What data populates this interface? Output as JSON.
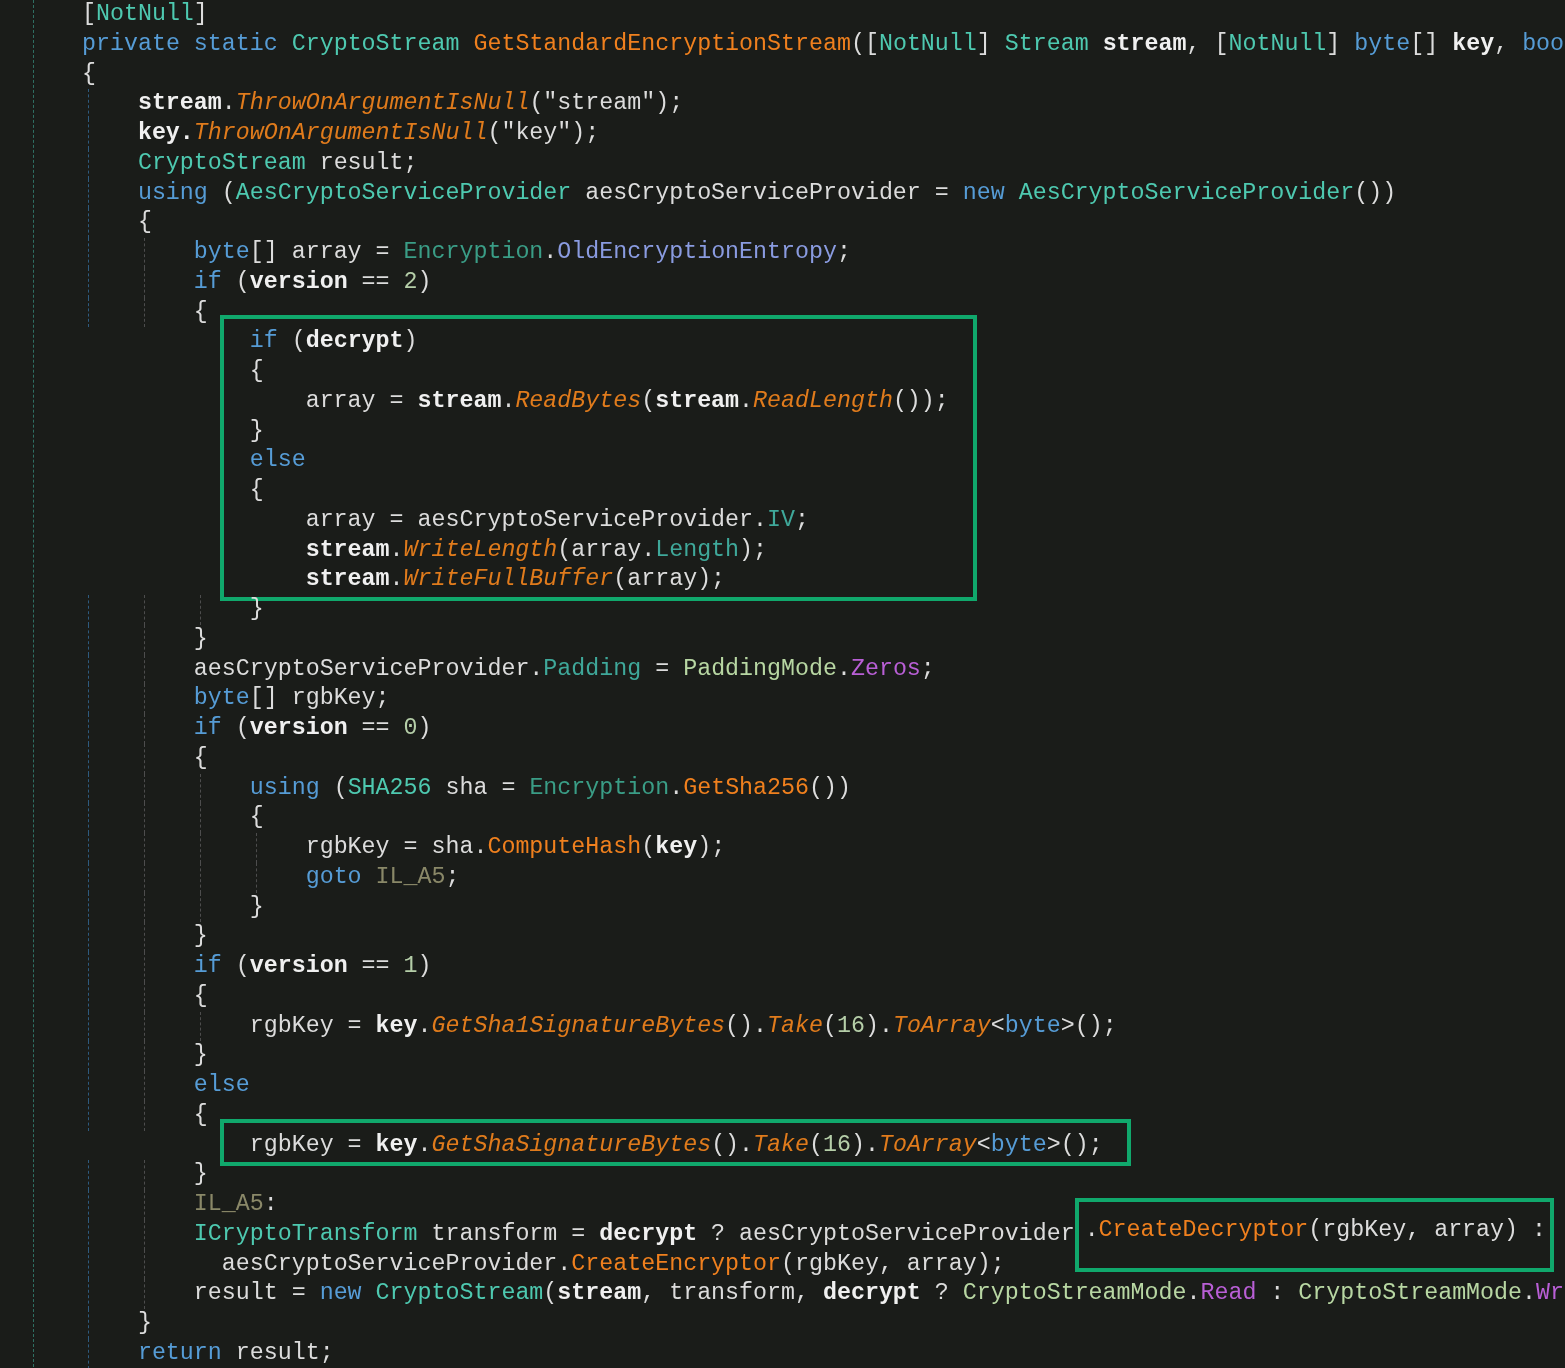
{
  "code_lines": [
    {
      "tokens": [
        {
          "text": "[",
          "kind": "plain"
        },
        {
          "text": "NotNull",
          "kind": "type"
        },
        {
          "text": "]",
          "kind": "plain"
        }
      ]
    },
    {
      "tokens": [
        {
          "text": "private static ",
          "kind": "keyword"
        },
        {
          "text": "CryptoStream ",
          "kind": "type"
        },
        {
          "text": "GetStandardEncryptionStream",
          "kind": "method"
        },
        {
          "text": "([",
          "kind": "plain"
        },
        {
          "text": "NotNull",
          "kind": "type"
        },
        {
          "text": "] ",
          "kind": "plain"
        },
        {
          "text": "Stream ",
          "kind": "type"
        },
        {
          "text": "stream",
          "kind": "parameter"
        },
        {
          "text": ", [",
          "kind": "plain"
        },
        {
          "text": "NotNull",
          "kind": "type"
        },
        {
          "text": "] ",
          "kind": "plain"
        },
        {
          "text": "byte",
          "kind": "keyword"
        },
        {
          "text": "[] ",
          "kind": "plain"
        },
        {
          "text": "key",
          "kind": "parameter"
        },
        {
          "text": ", ",
          "kind": "plain"
        },
        {
          "text": "boo",
          "kind": "keyword"
        }
      ]
    },
    {
      "tokens": [
        {
          "text": "{",
          "kind": "plain"
        }
      ]
    },
    {
      "tokens": [
        {
          "text": "    stream",
          "kind": "parameter"
        },
        {
          "text": ".",
          "kind": "plain"
        },
        {
          "text": "ThrowOnArgumentIsNull",
          "kind": "extension"
        },
        {
          "text": "(\"stream\");",
          "kind": "plain"
        }
      ]
    },
    {
      "tokens": [
        {
          "text": "    key.",
          "kind": "parameter"
        },
        {
          "text": "ThrowOnArgumentIsNull",
          "kind": "extension"
        },
        {
          "text": "(\"key\");",
          "kind": "plain"
        }
      ]
    },
    {
      "tokens": [
        {
          "text": "    CryptoStream",
          "kind": "type"
        },
        {
          "text": " result;",
          "kind": "plain"
        }
      ]
    },
    {
      "tokens": [
        {
          "text": "    using",
          "kind": "keyword"
        },
        {
          "text": " (",
          "kind": "plain"
        },
        {
          "text": "AesCryptoServiceProvider",
          "kind": "type"
        },
        {
          "text": " aesCryptoServiceProvider = ",
          "kind": "plain"
        },
        {
          "text": "new ",
          "kind": "keyword"
        },
        {
          "text": "AesCryptoServiceProvider",
          "kind": "type"
        },
        {
          "text": "())",
          "kind": "plain"
        }
      ]
    },
    {
      "tokens": [
        {
          "text": "    {",
          "kind": "plain"
        }
      ]
    },
    {
      "tokens": [
        {
          "text": "        byte",
          "kind": "keyword"
        },
        {
          "text": "[] array = ",
          "kind": "plain"
        },
        {
          "text": "Encryption",
          "kind": "static_type"
        },
        {
          "text": ".",
          "kind": "plain"
        },
        {
          "text": "OldEncryptionEntropy",
          "kind": "field"
        },
        {
          "text": ";",
          "kind": "plain"
        }
      ]
    },
    {
      "tokens": [
        {
          "text": "        if",
          "kind": "keyword"
        },
        {
          "text": " (",
          "kind": "plain"
        },
        {
          "text": "version",
          "kind": "parameter"
        },
        {
          "text": " == ",
          "kind": "plain"
        },
        {
          "text": "2",
          "kind": "number"
        },
        {
          "text": ")",
          "kind": "plain"
        }
      ]
    },
    {
      "tokens": [
        {
          "text": "        {",
          "kind": "plain"
        }
      ]
    },
    {
      "kind": "highlight",
      "lines": [
        {
          "tokens": [
            {
              "text": "            if",
              "kind": "keyword"
            },
            {
              "text": " (",
              "kind": "plain"
            },
            {
              "text": "decrypt",
              "kind": "parameter"
            },
            {
              "text": ")",
              "kind": "plain"
            }
          ]
        },
        {
          "tokens": [
            {
              "text": "            {",
              "kind": "plain"
            }
          ]
        },
        {
          "tokens": [
            {
              "text": "                array = ",
              "kind": "plain"
            },
            {
              "text": "stream",
              "kind": "parameter"
            },
            {
              "text": ".",
              "kind": "plain"
            },
            {
              "text": "ReadBytes",
              "kind": "extension"
            },
            {
              "text": "(",
              "kind": "plain"
            },
            {
              "text": "stream",
              "kind": "parameter"
            },
            {
              "text": ".",
              "kind": "plain"
            },
            {
              "text": "ReadLength",
              "kind": "extension"
            },
            {
              "text": "());",
              "kind": "plain"
            }
          ]
        },
        {
          "tokens": [
            {
              "text": "            }",
              "kind": "plain"
            }
          ]
        },
        {
          "tokens": [
            {
              "text": "            else",
              "kind": "keyword"
            }
          ]
        },
        {
          "tokens": [
            {
              "text": "            {",
              "kind": "plain"
            }
          ]
        },
        {
          "tokens": [
            {
              "text": "                array = aesCryptoServiceProvider.",
              "kind": "plain"
            },
            {
              "text": "IV",
              "kind": "property"
            },
            {
              "text": ";",
              "kind": "plain"
            }
          ]
        },
        {
          "tokens": [
            {
              "text": "                stream",
              "kind": "parameter"
            },
            {
              "text": ".",
              "kind": "plain"
            },
            {
              "text": "WriteLength",
              "kind": "extension"
            },
            {
              "text": "(array.",
              "kind": "plain"
            },
            {
              "text": "Length",
              "kind": "property"
            },
            {
              "text": ");",
              "kind": "plain"
            }
          ]
        },
        {
          "tokens": [
            {
              "text": "                stream",
              "kind": "parameter"
            },
            {
              "text": ".",
              "kind": "plain"
            },
            {
              "text": "WriteFullBuffer",
              "kind": "extension"
            },
            {
              "text": "(array);",
              "kind": "plain"
            }
          ]
        }
      ]
    },
    {
      "tokens": [
        {
          "text": "            }",
          "kind": "plain"
        }
      ]
    },
    {
      "tokens": [
        {
          "text": "        }",
          "kind": "plain"
        }
      ]
    },
    {
      "tokens": [
        {
          "text": "        aesCryptoServiceProvider.",
          "kind": "plain"
        },
        {
          "text": "Padding",
          "kind": "property"
        },
        {
          "text": " = ",
          "kind": "plain"
        },
        {
          "text": "PaddingMode",
          "kind": "enum_type"
        },
        {
          "text": ".",
          "kind": "plain"
        },
        {
          "text": "Zeros",
          "kind": "enum_member"
        },
        {
          "text": ";",
          "kind": "plain"
        }
      ]
    },
    {
      "tokens": [
        {
          "text": "        byte",
          "kind": "keyword"
        },
        {
          "text": "[] rgbKey;",
          "kind": "plain"
        }
      ]
    },
    {
      "tokens": [
        {
          "text": "        if",
          "kind": "keyword"
        },
        {
          "text": " (",
          "kind": "plain"
        },
        {
          "text": "version",
          "kind": "parameter"
        },
        {
          "text": " == ",
          "kind": "plain"
        },
        {
          "text": "0",
          "kind": "number"
        },
        {
          "text": ")",
          "kind": "plain"
        }
      ]
    },
    {
      "tokens": [
        {
          "text": "        {",
          "kind": "plain"
        }
      ]
    },
    {
      "tokens": [
        {
          "text": "            using",
          "kind": "keyword"
        },
        {
          "text": " (",
          "kind": "plain"
        },
        {
          "text": "SHA256",
          "kind": "type"
        },
        {
          "text": " sha = ",
          "kind": "plain"
        },
        {
          "text": "Encryption",
          "kind": "static_type"
        },
        {
          "text": ".",
          "kind": "plain"
        },
        {
          "text": "GetSha256",
          "kind": "method"
        },
        {
          "text": "())",
          "kind": "plain"
        }
      ]
    },
    {
      "tokens": [
        {
          "text": "            {",
          "kind": "plain"
        }
      ]
    },
    {
      "tokens": [
        {
          "text": "                rgbKey = sha.",
          "kind": "plain"
        },
        {
          "text": "ComputeHash",
          "kind": "method"
        },
        {
          "text": "(",
          "kind": "plain"
        },
        {
          "text": "key",
          "kind": "parameter"
        },
        {
          "text": ");",
          "kind": "plain"
        }
      ]
    },
    {
      "tokens": [
        {
          "text": "                goto ",
          "kind": "keyword"
        },
        {
          "text": "IL_A5",
          "kind": "label"
        },
        {
          "text": ";",
          "kind": "plain"
        }
      ]
    },
    {
      "tokens": [
        {
          "text": "            }",
          "kind": "plain"
        }
      ]
    },
    {
      "tokens": [
        {
          "text": "        }",
          "kind": "plain"
        }
      ]
    },
    {
      "tokens": [
        {
          "text": "        if",
          "kind": "keyword"
        },
        {
          "text": " (",
          "kind": "plain"
        },
        {
          "text": "version",
          "kind": "parameter"
        },
        {
          "text": " == ",
          "kind": "plain"
        },
        {
          "text": "1",
          "kind": "number"
        },
        {
          "text": ")",
          "kind": "plain"
        }
      ]
    },
    {
      "tokens": [
        {
          "text": "        {",
          "kind": "plain"
        }
      ]
    },
    {
      "tokens": [
        {
          "text": "            rgbKey = ",
          "kind": "plain"
        },
        {
          "text": "key",
          "kind": "parameter"
        },
        {
          "text": ".",
          "kind": "plain"
        },
        {
          "text": "GetSha1SignatureBytes",
          "kind": "extension"
        },
        {
          "text": "().",
          "kind": "plain"
        },
        {
          "text": "Take",
          "kind": "extension"
        },
        {
          "text": "(",
          "kind": "plain"
        },
        {
          "text": "16",
          "kind": "number"
        },
        {
          "text": ").",
          "kind": "plain"
        },
        {
          "text": "ToArray",
          "kind": "extension"
        },
        {
          "text": "<",
          "kind": "plain"
        },
        {
          "text": "byte",
          "kind": "keyword"
        },
        {
          "text": ">();",
          "kind": "plain"
        }
      ]
    },
    {
      "tokens": [
        {
          "text": "        }",
          "kind": "plain"
        }
      ]
    },
    {
      "tokens": [
        {
          "text": "        else",
          "kind": "keyword"
        }
      ]
    },
    {
      "tokens": [
        {
          "text": "        {",
          "kind": "plain"
        }
      ]
    },
    {
      "kind": "highlight",
      "lines": [
        {
          "tokens": [
            {
              "text": "            rgbKey = ",
              "kind": "plain"
            },
            {
              "text": "key",
              "kind": "parameter"
            },
            {
              "text": ".",
              "kind": "plain"
            },
            {
              "text": "GetShaSignatureBytes",
              "kind": "extension"
            },
            {
              "text": "().",
              "kind": "plain"
            },
            {
              "text": "Take",
              "kind": "extension"
            },
            {
              "text": "(",
              "kind": "plain"
            },
            {
              "text": "16",
              "kind": "number"
            },
            {
              "text": ").",
              "kind": "plain"
            },
            {
              "text": "ToArray",
              "kind": "extension"
            },
            {
              "text": "<",
              "kind": "plain"
            },
            {
              "text": "byte",
              "kind": "keyword"
            },
            {
              "text": ">();",
              "kind": "plain"
            }
          ]
        }
      ]
    },
    {
      "tokens": [
        {
          "text": "        }",
          "kind": "plain"
        }
      ]
    },
    {
      "tokens": [
        {
          "text": "        IL_A5",
          "kind": "label"
        },
        {
          "text": ":",
          "kind": "plain"
        }
      ]
    },
    {
      "tokens": [
        {
          "text": "        ICryptoTransform",
          "kind": "type"
        },
        {
          "text": " transform = ",
          "kind": "plain"
        },
        {
          "text": "decrypt",
          "kind": "parameter"
        },
        {
          "text": " ? aesCryptoServiceProvider",
          "kind": "plain"
        },
        {
          "kind": "highlight",
          "tokens": [
            {
              "text": ".",
              "kind": "plain"
            },
            {
              "text": "CreateDecryptor",
              "kind": "method"
            },
            {
              "text": "(rgbKey, array) :",
              "kind": "plain"
            }
          ]
        }
      ]
    },
    {
      "tokens": [
        {
          "text": "          aesCryptoServiceProvider.",
          "kind": "plain"
        },
        {
          "text": "CreateEncryptor",
          "kind": "method"
        },
        {
          "text": "(rgbKey, array);",
          "kind": "plain"
        }
      ]
    },
    {
      "tokens": [
        {
          "text": "        result = ",
          "kind": "plain"
        },
        {
          "text": "new ",
          "kind": "keyword"
        },
        {
          "text": "CryptoStream",
          "kind": "type"
        },
        {
          "text": "(",
          "kind": "plain"
        },
        {
          "text": "stream",
          "kind": "parameter"
        },
        {
          "text": ", transform, ",
          "kind": "plain"
        },
        {
          "text": "decrypt",
          "kind": "parameter"
        },
        {
          "text": " ? ",
          "kind": "plain"
        },
        {
          "text": "CryptoStreamMode",
          "kind": "enum_type"
        },
        {
          "text": ".",
          "kind": "plain"
        },
        {
          "text": "Read",
          "kind": "enum_member"
        },
        {
          "text": " : ",
          "kind": "plain"
        },
        {
          "text": "CryptoStreamMode",
          "kind": "enum_type"
        },
        {
          "text": ".",
          "kind": "plain"
        },
        {
          "text": "Wr",
          "kind": "enum_member"
        }
      ]
    },
    {
      "tokens": [
        {
          "text": "    }",
          "kind": "plain"
        }
      ]
    },
    {
      "tokens": [
        {
          "text": "    return",
          "kind": "keyword"
        },
        {
          "text": " result;",
          "kind": "plain"
        }
      ]
    }
  ]
}
